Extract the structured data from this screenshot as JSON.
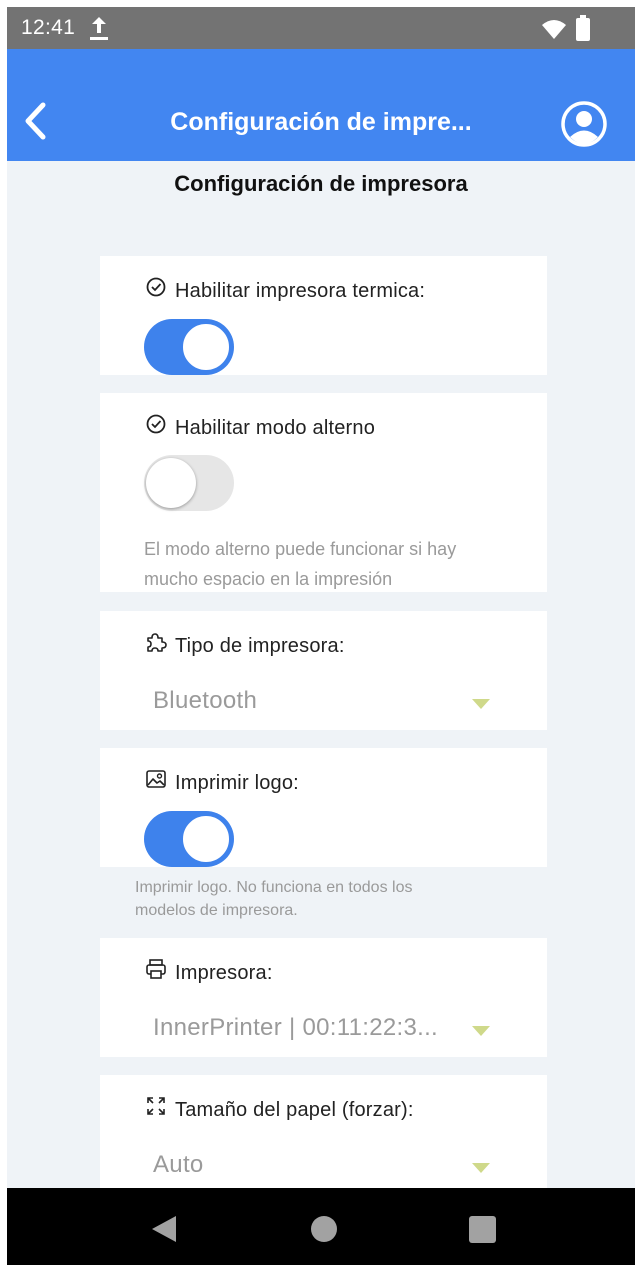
{
  "status_bar": {
    "time": "12:41"
  },
  "app_bar": {
    "title": "Configuración de impre..."
  },
  "page": {
    "title": "Configuración de impresora"
  },
  "settings": {
    "thermal_printer": {
      "label": "Habilitar impresora termica:",
      "enabled": true
    },
    "alternate_mode": {
      "label": "Habilitar modo alterno",
      "enabled": false,
      "help_line1": "El modo alterno puede funcionar si hay",
      "help_line2": "mucho espacio en la impresión"
    },
    "printer_type": {
      "label": "Tipo de impresora:",
      "value": "Bluetooth"
    },
    "print_logo": {
      "label": "Imprimir logo:",
      "enabled": true,
      "help_line1": "Imprimir logo. No funciona en todos los",
      "help_line2": "modelos de impresora."
    },
    "printer": {
      "label": "Impresora:",
      "value": "InnerPrinter | 00:11:22:3..."
    },
    "paper_size": {
      "label": "Tamaño del papel (forzar):",
      "value": "Auto"
    }
  },
  "colors": {
    "app_bar": "#4286f1",
    "toggle_on": "#3e82ec",
    "dropdown_caret": "#cfd98a"
  }
}
